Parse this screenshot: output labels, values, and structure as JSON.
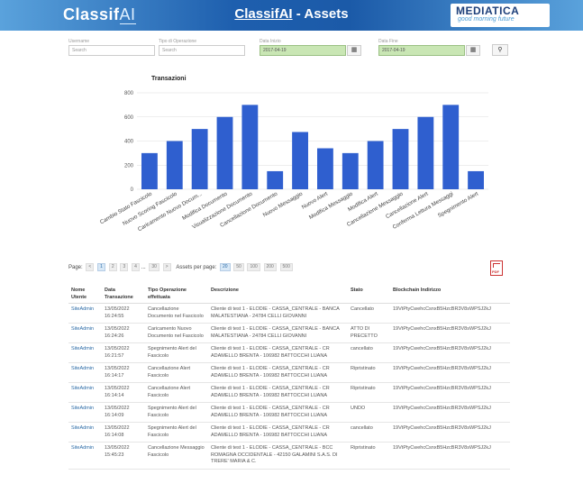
{
  "header": {
    "logo_left_main": "Classif",
    "logo_left_accent": "AI",
    "title_brand": "ClassifAI",
    "title_rest": " - Assets",
    "logo_right_top": "MEDIATICA",
    "logo_right_bottom": "good morning future"
  },
  "filters": {
    "username_label": "Username",
    "username_placeholder": "Search",
    "optype_label": "Tipo di Operazione",
    "optype_placeholder": "Search",
    "start_label": "Data Inizio",
    "start_value": "2017-04-19",
    "end_label": "Data Fine",
    "end_value": "2017-04-19"
  },
  "chart_data": {
    "type": "bar",
    "title": "Transazioni",
    "ylim": [
      0,
      800
    ],
    "yticks": [
      0,
      200,
      400,
      600,
      800
    ],
    "grid": true,
    "color": "#2f5fcf",
    "categories": [
      "Cambio Stato Fascicolo",
      "Nuovo Scoring Fascicolo",
      "Caricamento Nuovo Docum...",
      "Modifica Documento",
      "Visualizzazione Documento",
      "Cancellazione Documento",
      "Nuovo Messaggio",
      "Nuovo Alert",
      "Modifica Messaggio",
      "Modifica Alert",
      "Cancellazione Messaggio",
      "Cancellazione Alert",
      "Conferma Lettura Messaggi",
      "Spegnimento Alert"
    ],
    "values": [
      300,
      400,
      500,
      600,
      700,
      150,
      475,
      340,
      300,
      400,
      500,
      600,
      700,
      150
    ]
  },
  "pager": {
    "label": "Page:",
    "prev": "<",
    "pages": [
      "1",
      "2",
      "3",
      "4"
    ],
    "ellipsis": "...",
    "last": "30",
    "next": ">",
    "per_page_label": "Assets per page:",
    "per_page_options": [
      "20",
      "50",
      "100",
      "200",
      "500"
    ],
    "pdf_label": "PDF"
  },
  "table": {
    "headers": [
      "Nome Utente",
      "Data Transazione",
      "Tipo Operazione effettuata",
      "Descrizione",
      "Stato",
      "Blockchain Indirizzo"
    ],
    "rows": [
      [
        "SiteAdmin",
        "13/05/2022 16:24:55",
        "Cancellazione Documento nel Fascicolo",
        "Cliente di test 1 - ELODIE - CASSA_CENTRALE - BANCA MALATESTIANA - 24784 CELLI GIOVANNI",
        "Cancellato",
        "19VtPtyCwehcCsnxB5HzcBR3V8sWPSJ2kJ"
      ],
      [
        "SiteAdmin",
        "13/05/2022 16:24:26",
        "Caricamento Nuovo Documento nel Fascicolo",
        "Cliente di test 1 - ELODIE - CASSA_CENTRALE - BANCA MALATESTIANA - 24784 CELLI GIOVANNI",
        "ATTO DI PRECETTO",
        "19VtPtyCwehcCsnxB5HzcBR3V8sWPSJ2kJ"
      ],
      [
        "SiteAdmin",
        "13/05/2022 16:21:57",
        "Spegnimento Alert del Fascicolo",
        "Cliente di test 1 - ELODIE - CASSA_CENTRALE - CR ADAMELLO BRENTA - 106982 BATTOCCHI LUANA",
        "cancellato",
        "19VtPtyCwehcCsnxB5HzcBR3V8sWPSJ2kJ"
      ],
      [
        "SiteAdmin",
        "13/05/2022 16:14:17",
        "Cancellazione Alert Fascicolo",
        "Cliente di test 1 - ELODIE - CASSA_CENTRALE - CR ADAMELLO BRENTA - 106982 BATTOCCHI LUANA",
        "Ripristinato",
        "19VtPtyCwehcCsnxB5HzcBR3V8sWPSJ2kJ"
      ],
      [
        "SiteAdmin",
        "13/05/2022 16:14:14",
        "Cancellazione Alert Fascicolo",
        "Cliente di test 1 - ELODIE - CASSA_CENTRALE - CR ADAMELLO BRENTA - 106982 BATTOCCHI LUANA",
        "Ripristinato",
        "19VtPtyCwehcCsnxB5HzcBR3V8sWPSJ2kJ"
      ],
      [
        "SiteAdmin",
        "13/05/2022 16:14:09",
        "Spegnimento Alert del Fascicolo",
        "Cliente di test 1 - ELODIE - CASSA_CENTRALE - CR ADAMELLO BRENTA - 106982 BATTOCCHI LUANA",
        "UNDO",
        "19VtPtyCwehcCsnxB5HzcBR3V8sWPSJ2kJ"
      ],
      [
        "SiteAdmin",
        "13/05/2022 16:14:08",
        "Spegnimento Alert del Fascicolo",
        "Cliente di test 1 - ELODIE - CASSA_CENTRALE - CR ADAMELLO BRENTA - 106982 BATTOCCHI LUANA",
        "cancellato",
        "19VtPtyCwehcCsnxB5HzcBR3V8sWPSJ2kJ"
      ],
      [
        "SiteAdmin",
        "13/05/2022 15:45:23",
        "Cancellazione Messaggio Fascicolo",
        "Cliente di test 1 - ELODIE - CASSA_CENTRALE - BCC ROMAGNA OCCIDENTALE - 42150 GALAMINI S.A.S. DI TRERE' MARIA & C.",
        "Ripristinato",
        "19VtPtyCwehcCsnxB5HzcBR3V8sWPSJ2kJ"
      ]
    ]
  }
}
